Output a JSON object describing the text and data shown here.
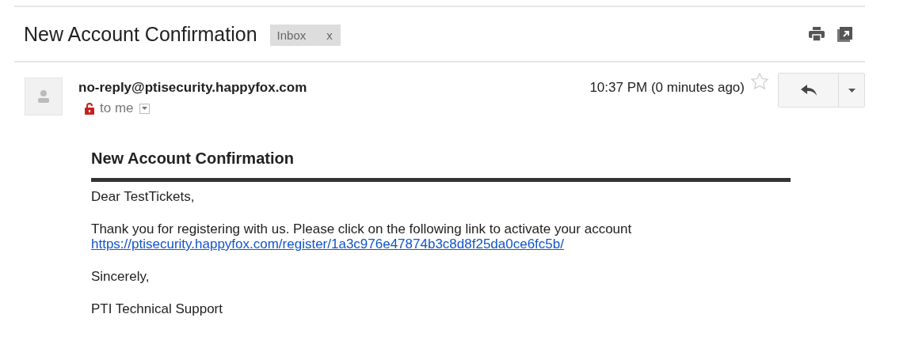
{
  "subject": "New Account Confirmation",
  "labels": [
    {
      "text": "Inbox",
      "remove": "x"
    }
  ],
  "message": {
    "sender": "no-reply@ptisecurity.happyfox.com",
    "recipient": "to me",
    "encrypted": false,
    "time": "10:37 PM (0 minutes ago)",
    "starred": false
  },
  "body": {
    "heading": "New Account Confirmation",
    "greeting": "Dear TestTickets,",
    "text": "Thank you for registering with us. Please click on the following link to activate your account",
    "link": "https://ptisecurity.happyfox.com/register/1a3c976e47874b3c8d8f25da0ce6fc5b/",
    "closing": "Sincerely,",
    "signature": "PTI Technical Support"
  }
}
